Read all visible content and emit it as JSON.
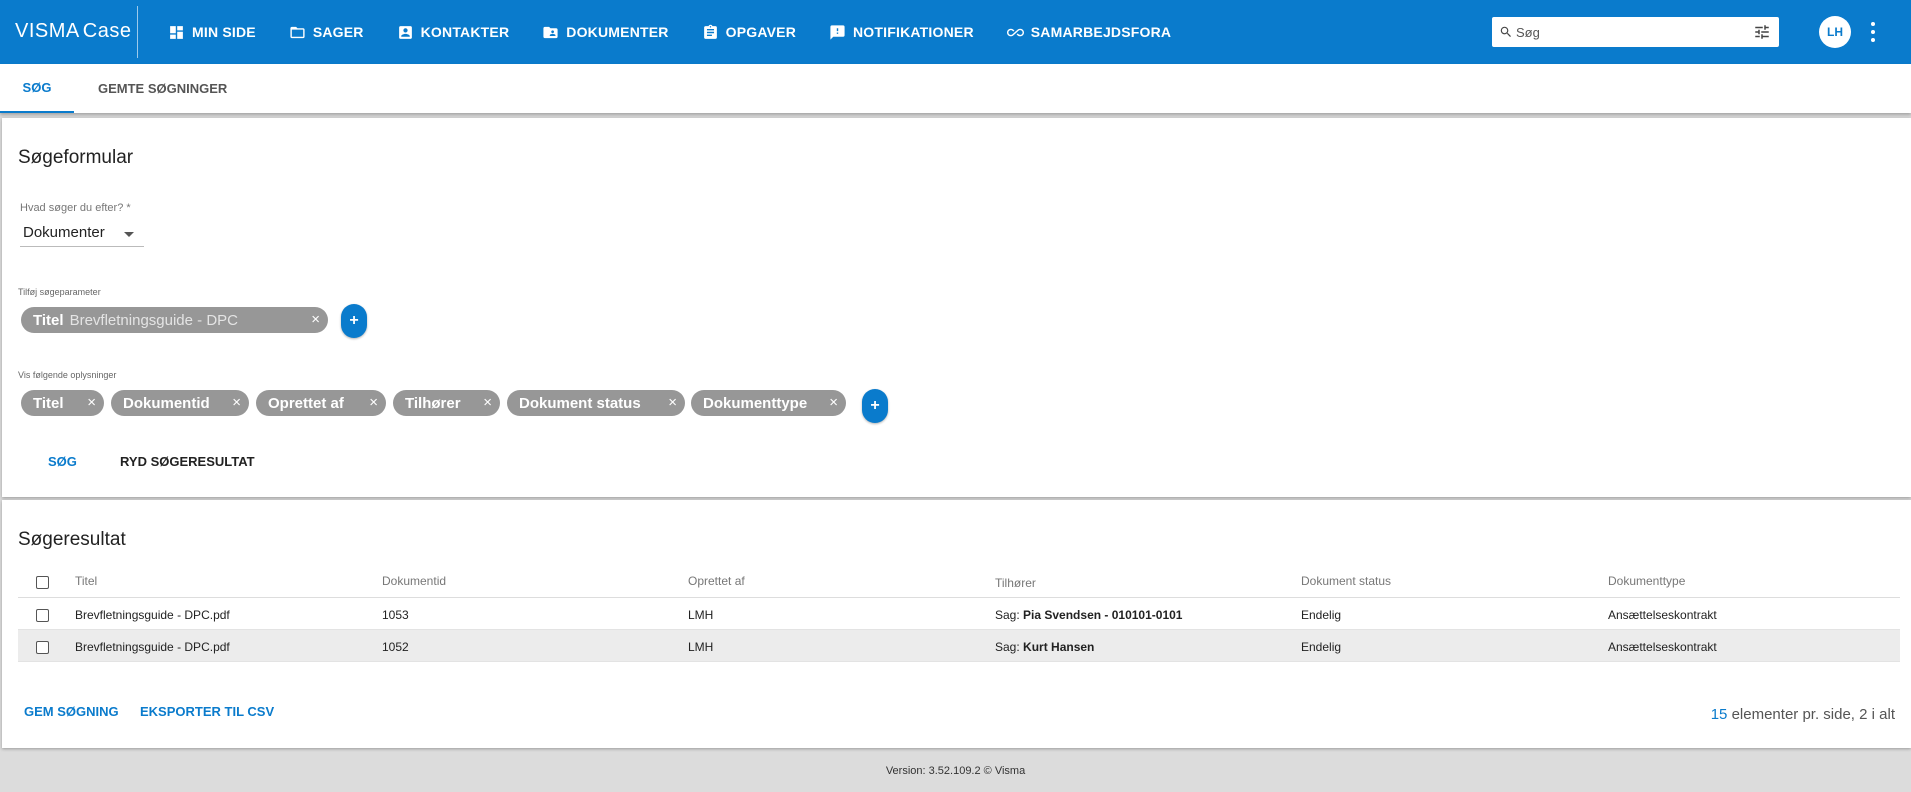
{
  "app": {
    "brand_primary": "VISMA",
    "brand_secondary": "Case",
    "accent_color": "#0a7bcc"
  },
  "nav": [
    {
      "label": "MIN SIDE",
      "icon": "dashboard-icon"
    },
    {
      "label": "SAGER",
      "icon": "folder-icon"
    },
    {
      "label": "KONTAKTER",
      "icon": "contact-card-icon"
    },
    {
      "label": "DOKUMENTER",
      "icon": "shared-folder-icon"
    },
    {
      "label": "OPGAVER",
      "icon": "clipboard-icon"
    },
    {
      "label": "NOTIFIKATIONER",
      "icon": "feedback-icon"
    },
    {
      "label": "SAMARBEJDSFORA",
      "icon": "infinity-icon"
    }
  ],
  "search": {
    "placeholder": "Søg"
  },
  "user": {
    "initials": "LH"
  },
  "tabs": [
    {
      "label": "SØG",
      "active": true
    },
    {
      "label": "GEMTE SØGNINGER",
      "active": false
    }
  ],
  "form": {
    "title": "Søgeformular",
    "search_for_label": "Hvad søger du efter? *",
    "search_for_value": "Dokumenter",
    "params_label": "Tilføj søgeparameter",
    "params": [
      {
        "key": "Titel",
        "value": "Brevfletningsguide - DPC"
      }
    ],
    "show_label": "Vis følgende oplysninger",
    "show_fields": [
      "Titel",
      "Dokumentid",
      "Oprettet af",
      "Tilhører",
      "Dokument status",
      "Dokumenttype"
    ],
    "add_symbol": "+",
    "remove_symbol": "×",
    "search_button": "SØG",
    "clear_button": "RYD SØGERESULTAT"
  },
  "results": {
    "title": "Søgeresultat",
    "columns": [
      "Titel",
      "Dokumentid",
      "Oprettet af",
      "Tilhører",
      "Dokument status",
      "Dokumenttype"
    ],
    "rows": [
      {
        "title": "Brevfletningsguide - DPC.pdf",
        "id": "1053",
        "created_by": "LMH",
        "belongs_prefix": "Sag:",
        "belongs_name": "Pia Svendsen - 010101-0101",
        "status": "Endelig",
        "type": "Ansættelseskontrakt"
      },
      {
        "title": "Brevfletningsguide - DPC.pdf",
        "id": "1052",
        "created_by": "LMH",
        "belongs_prefix": "Sag:",
        "belongs_name": "Kurt Hansen",
        "status": "Endelig",
        "type": "Ansættelseskontrakt"
      }
    ],
    "save_button": "GEM SØGNING",
    "export_button": "EKSPORTER TIL CSV",
    "per_page": "15",
    "pager_text": " elementer pr. side, 2 i alt"
  },
  "footer": {
    "text": "Version: 3.52.109.2  © Visma"
  }
}
